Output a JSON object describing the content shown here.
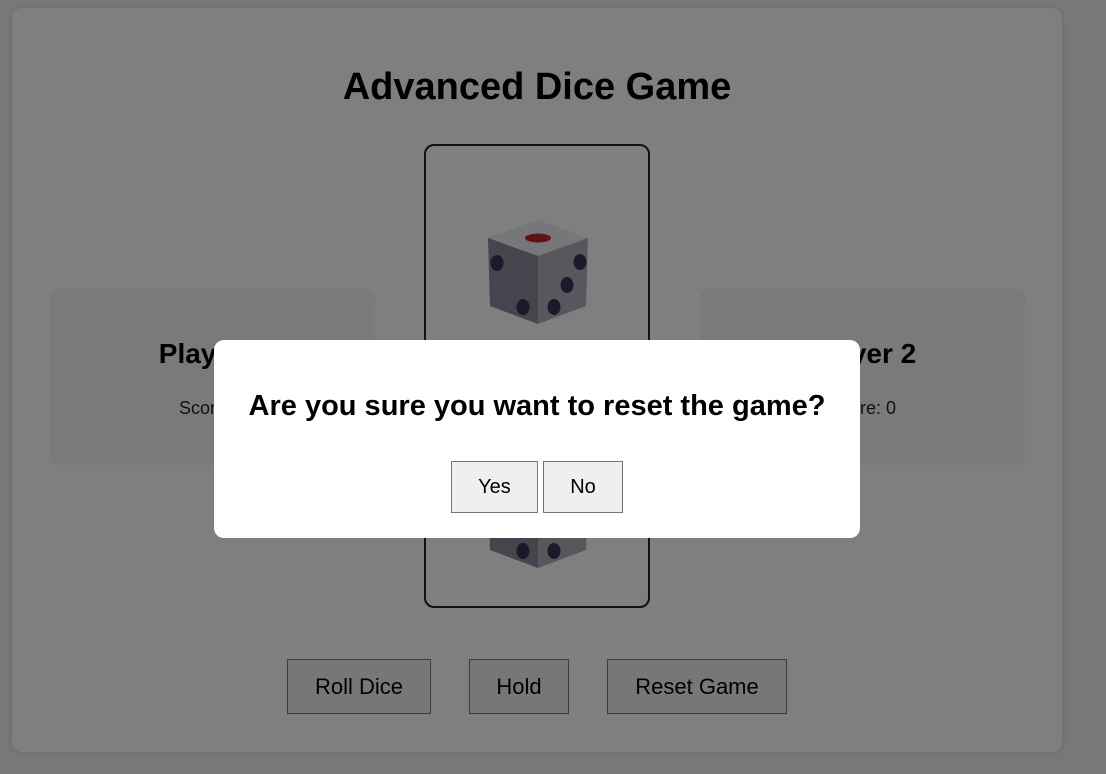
{
  "game": {
    "title": "Advanced Dice Game"
  },
  "players": [
    {
      "name": "Player 1",
      "score_label": "Score: 0"
    },
    {
      "name": "Player 2",
      "score_label": "Score: 0"
    }
  ],
  "dice": {
    "die1": {
      "top_face": 1,
      "left_face": 2,
      "right_face": 3
    },
    "die2": {
      "top_face": 1,
      "left_face": 2,
      "right_face": 3
    },
    "colors": {
      "pip": "#3a3355",
      "top_pip": "#c0262d",
      "face_light": "#eeedf2",
      "face_mid": "#8c8899",
      "face_dark": "#b3afbd"
    }
  },
  "controls": {
    "roll_label": "Roll Dice",
    "hold_label": "Hold",
    "reset_label": "Reset Game"
  },
  "modal": {
    "message": "Are you sure you want to reset the game?",
    "yes_label": "Yes",
    "no_label": "No"
  }
}
